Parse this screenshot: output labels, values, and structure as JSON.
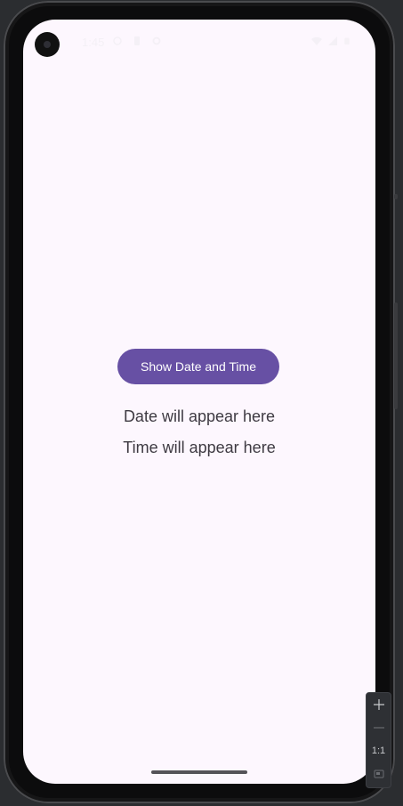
{
  "status_bar": {
    "time": "1:45",
    "icons_left": [
      "notification-icon",
      "sim-card-icon",
      "settings-icon"
    ],
    "icons_right": [
      "wifi-icon",
      "signal-icon",
      "battery-icon"
    ]
  },
  "app": {
    "button_label": "Show Date and Time",
    "date_text": "Date will appear here",
    "time_text": "Time will appear here"
  },
  "emulator": {
    "zoom_reset_label": "1:1"
  },
  "colors": {
    "background": "#fdf7fe",
    "button": "#6750a4",
    "button_text": "#ffffff",
    "body_text": "#3e3a42"
  }
}
